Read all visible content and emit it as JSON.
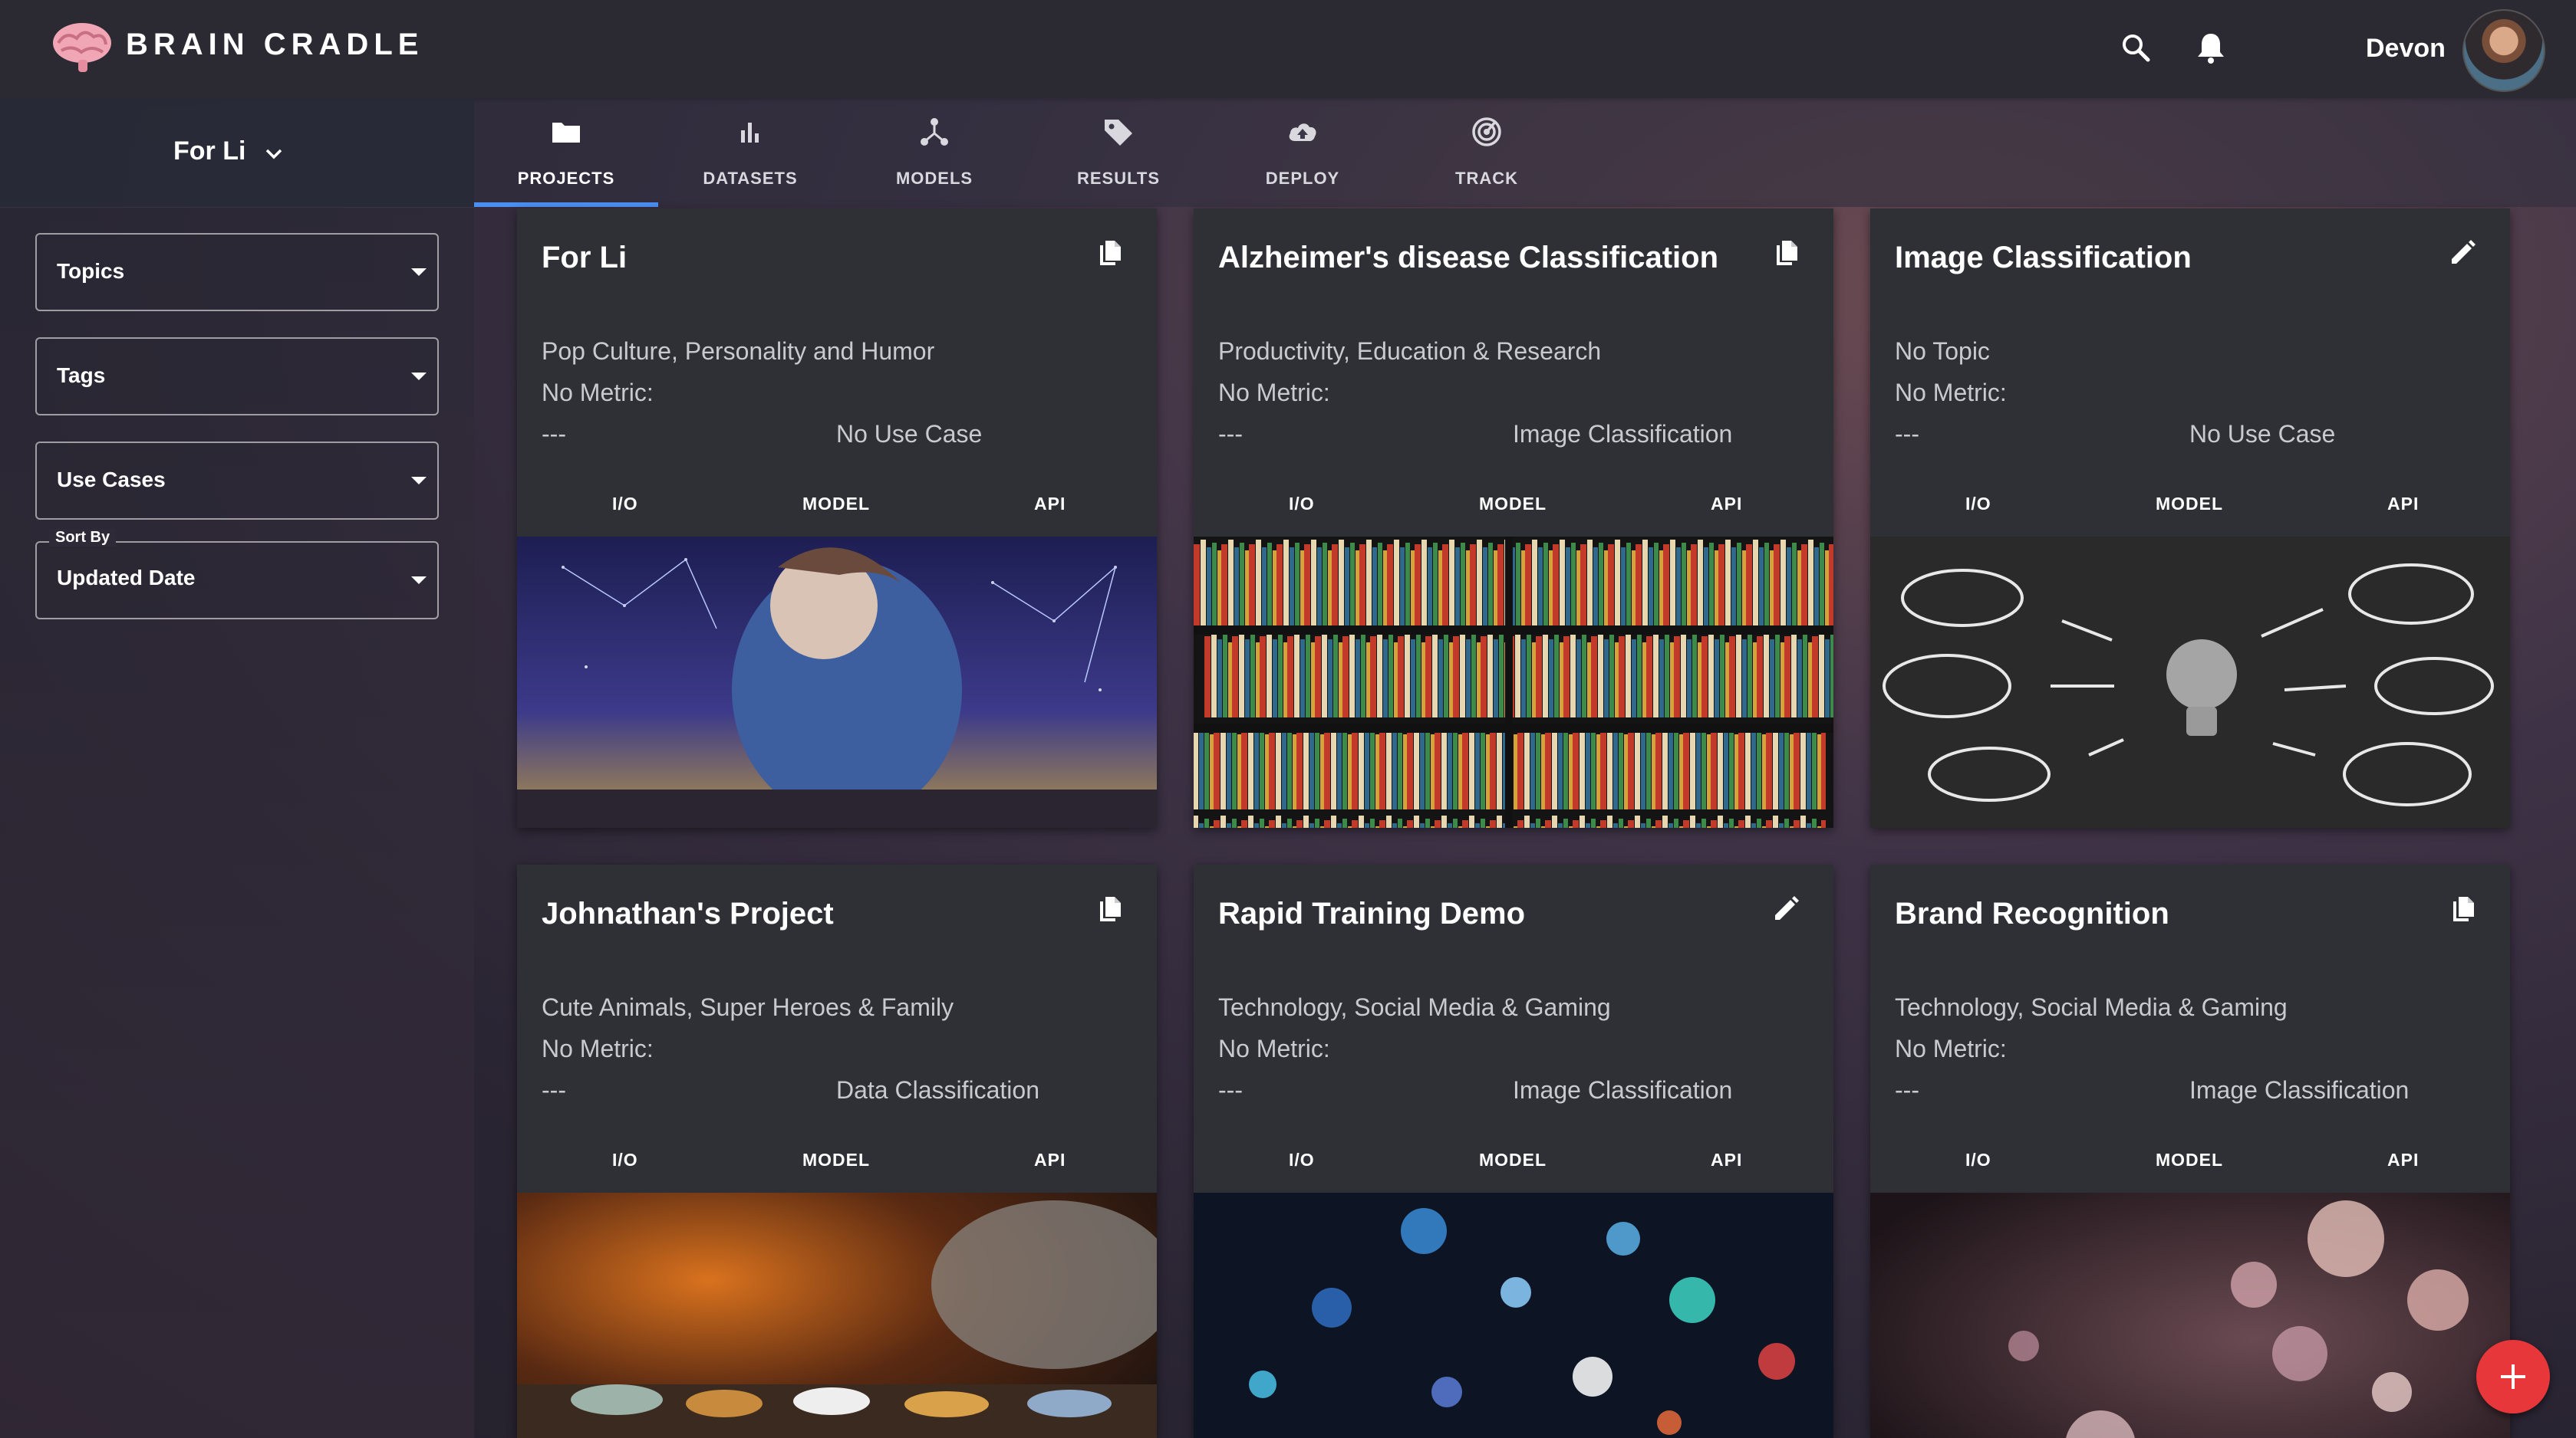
{
  "header": {
    "brand": "BRAIN CRADLE",
    "logo_icon": "brain-icon",
    "search_icon": "search-icon",
    "notifications_icon": "bell-icon",
    "username": "Devon"
  },
  "project_selector": {
    "value": "For Li"
  },
  "filters": {
    "topics": "Topics",
    "tags": "Tags",
    "use_cases": "Use Cases",
    "sort_label": "Sort By",
    "sort_value": "Updated Date"
  },
  "tabs": [
    {
      "label": "PROJECTS",
      "icon": "folder-icon",
      "active": true
    },
    {
      "label": "DATASETS",
      "icon": "bar-chart-icon"
    },
    {
      "label": "MODELS",
      "icon": "network-icon"
    },
    {
      "label": "RESULTS",
      "icon": "tag-icon"
    },
    {
      "label": "DEPLOY",
      "icon": "cloud-upload-icon"
    },
    {
      "label": "TRACK",
      "icon": "radar-icon"
    }
  ],
  "cards": [
    {
      "title": "For Li",
      "action_icon": "copy-icon",
      "topic": "Pop Culture, Personality and Humor",
      "metric": "No Metric:",
      "dash": "---",
      "use_case": "No Use Case",
      "io": "I/O",
      "model": "MODEL",
      "api": "API"
    },
    {
      "title": "Alzheimer's disease Classification",
      "action_icon": "copy-icon",
      "topic": "Productivity, Education & Research",
      "metric": "No Metric:",
      "dash": "---",
      "use_case": "Image Classification",
      "io": "I/O",
      "model": "MODEL",
      "api": "API"
    },
    {
      "title": "Image Classification",
      "action_icon": "edit-icon",
      "topic": "No Topic",
      "metric": "No Metric:",
      "dash": "---",
      "use_case": "No Use Case",
      "io": "I/O",
      "model": "MODEL",
      "api": "API"
    },
    {
      "title": "Johnathan's Project",
      "action_icon": "copy-icon",
      "topic": "Cute Animals, Super Heroes & Family",
      "metric": "No Metric:",
      "dash": "---",
      "use_case": "Data Classification",
      "io": "I/O",
      "model": "MODEL",
      "api": "API"
    },
    {
      "title": "Rapid Training Demo",
      "action_icon": "edit-icon",
      "topic": "Technology, Social Media & Gaming",
      "metric": "No Metric:",
      "dash": "---",
      "use_case": "Image Classification",
      "io": "I/O",
      "model": "MODEL",
      "api": "API"
    },
    {
      "title": "Brand Recognition",
      "action_icon": "copy-icon",
      "topic": "Technology, Social Media & Gaming",
      "metric": "No Metric:",
      "dash": "---",
      "use_case": "Image Classification",
      "io": "I/O",
      "model": "MODEL",
      "api": "API"
    }
  ],
  "fab_icon": "plus-icon",
  "colors": {
    "accent": "#4c8ff2",
    "fab": "#e8373b",
    "card": "#2f2f36",
    "topbar": "#2b2a33"
  }
}
